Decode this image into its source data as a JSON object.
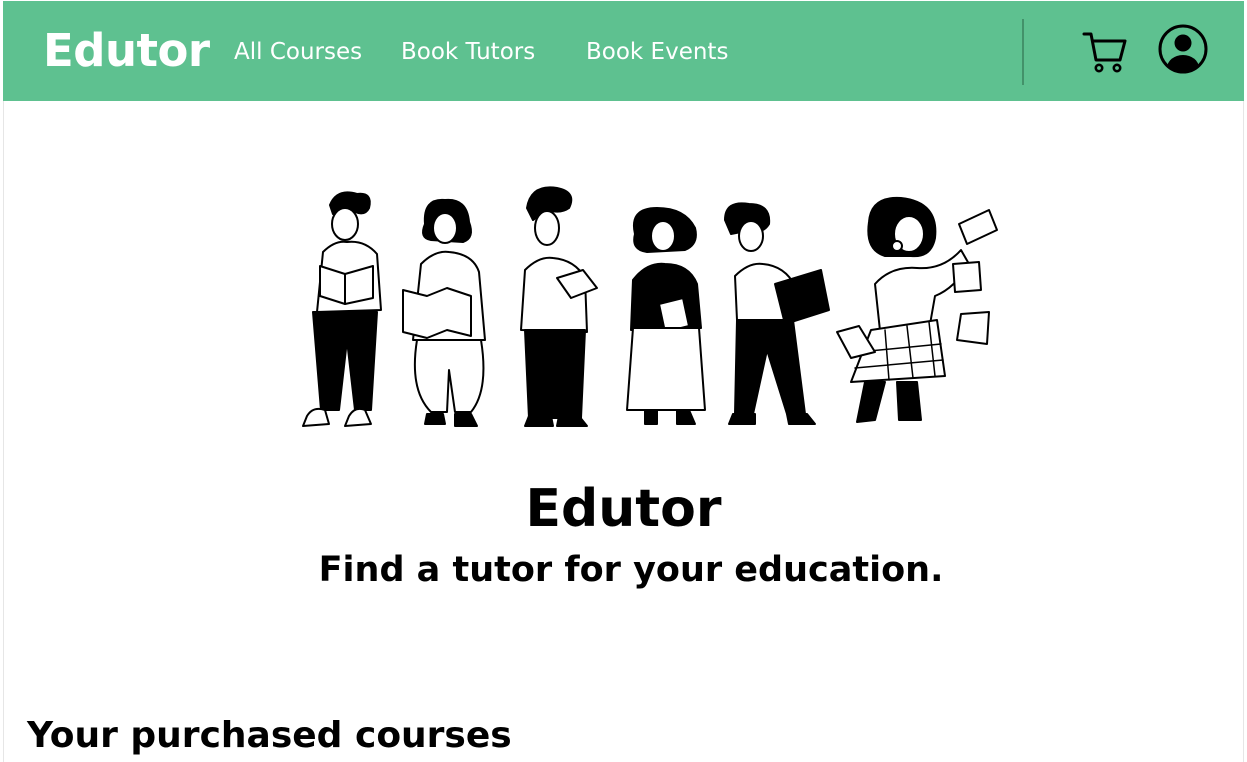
{
  "navbar": {
    "brand": "Edutor",
    "links": [
      "All Courses",
      "Book Tutors",
      "Book Events"
    ],
    "icons": [
      "cart-icon",
      "user-avatar-icon"
    ],
    "background": "#5ec190"
  },
  "hero": {
    "title": "Edutor",
    "subtitle": "Find a tutor for your education."
  },
  "purchased": {
    "title": "Your purchased courses"
  }
}
